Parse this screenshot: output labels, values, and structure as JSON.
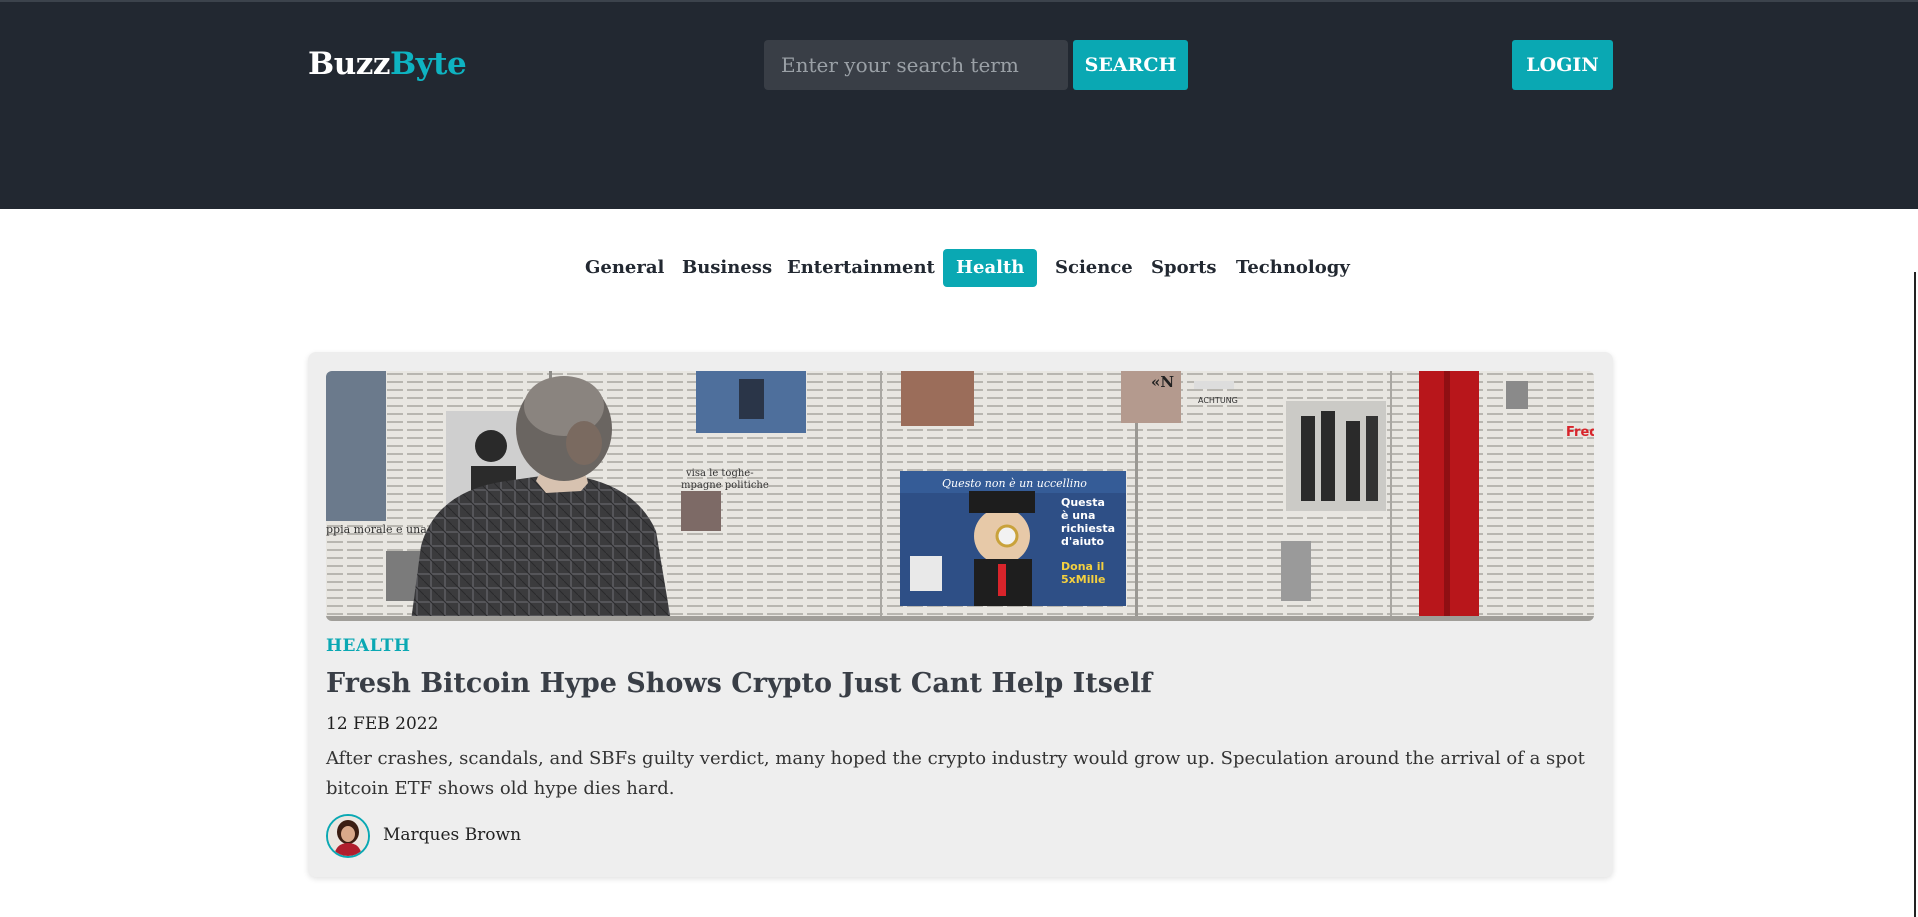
{
  "header": {
    "logo_part1": "Buzz",
    "logo_part2": "Byte",
    "search_placeholder": "Enter your search term",
    "search_label": "SEARCH",
    "login_label": "LOGIN"
  },
  "nav": {
    "items": [
      {
        "label": "General"
      },
      {
        "label": "Business"
      },
      {
        "label": "Entertainment"
      },
      {
        "label": "Health",
        "active": true
      },
      {
        "label": "Science"
      },
      {
        "label": "Sports"
      },
      {
        "label": "Technology"
      }
    ]
  },
  "article": {
    "category": "HEALTH",
    "title": "Fresh Bitcoin Hype Shows Crypto Just Cant Help Itself",
    "date": "12 FEB 2022",
    "excerpt": "After crashes, scandals, and SBFs guilty verdict, many hoped the crypto industry would grow up. Speculation around the arrival of a spot bitcoin ETF shows old hype dies hard.",
    "author": "Marques Brown",
    "image_text": {
      "caption1": "ppia morale e una malattia m",
      "caption2": "visa le toghe-",
      "caption3": "mpagne politiche",
      "ad_line1": "Questo non è un uccellino",
      "ad_line2": "Questa",
      "ad_line3": "è una",
      "ad_line4": "richiesta",
      "ad_line5": "d'aiuto",
      "ad_line6": "Dona il",
      "ad_line7": "5xMille",
      "mark1": "«N",
      "mark2": "ACHTUNG",
      "mark3": "Fred"
    }
  },
  "colors": {
    "header_bg": "#222831",
    "accent": "#0aa8b3",
    "card_bg": "#eeeeee"
  }
}
